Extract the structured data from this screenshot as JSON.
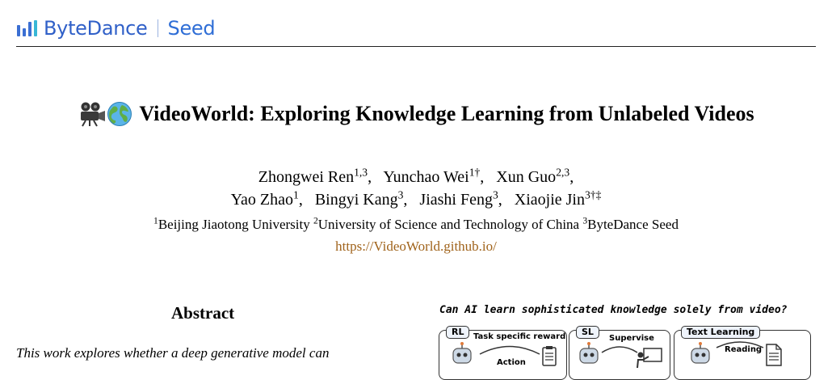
{
  "header": {
    "brand": "ByteDance",
    "sub_brand": "Seed",
    "brand_color": "#3060c8"
  },
  "title": "VideoWorld: Exploring Knowledge Learning from Unlabeled Videos",
  "title_icons": [
    "movie-camera-icon",
    "globe-icon"
  ],
  "authors": {
    "line1": [
      {
        "name": "Zhongwei Ren",
        "sup": "1,3",
        "sep": ","
      },
      {
        "name": "Yunchao Wei",
        "sup": "1†",
        "sep": ","
      },
      {
        "name": "Xun Guo",
        "sup": "2,3",
        "sep": ","
      }
    ],
    "line2": [
      {
        "name": "Yao Zhao",
        "sup": "1",
        "sep": ","
      },
      {
        "name": "Bingyi Kang",
        "sup": "3",
        "sep": ","
      },
      {
        "name": "Jiashi Feng",
        "sup": "3",
        "sep": ","
      },
      {
        "name": "Xiaojie Jin",
        "sup": "3†‡",
        "sep": ""
      }
    ]
  },
  "affiliations": [
    {
      "sup": "1",
      "name": "Beijing Jiaotong University"
    },
    {
      "sup": "2",
      "name": "University of Science and Technology of China"
    },
    {
      "sup": "3",
      "name": "ByteDance Seed"
    }
  ],
  "url": "https://VideoWorld.github.io/",
  "abstract": {
    "heading": "Abstract",
    "first_line": "This work explores whether a deep generative model can"
  },
  "figure": {
    "question": "Can AI learn sophisticated knowledge solely from video?",
    "panels": [
      {
        "tag": "RL",
        "caption": "Task specific reward",
        "sub": "Action"
      },
      {
        "tag": "SL",
        "caption": "Supervise",
        "sub": ""
      },
      {
        "tag": "Text Learning",
        "caption": "Reading",
        "sub": ""
      }
    ]
  }
}
